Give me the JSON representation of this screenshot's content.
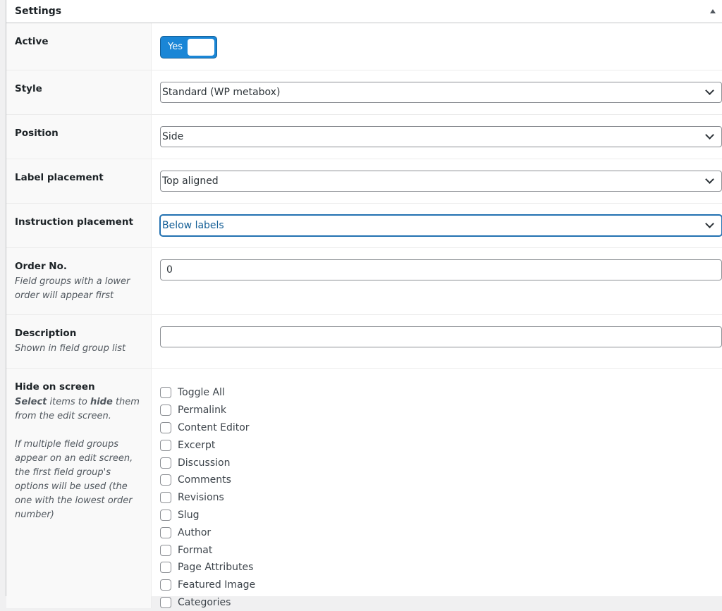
{
  "panel": {
    "title": "Settings"
  },
  "active": {
    "label": "Active",
    "toggle_text": "Yes"
  },
  "style": {
    "label": "Style",
    "value": "Standard (WP metabox)"
  },
  "position": {
    "label": "Position",
    "value": "Side"
  },
  "label_placement": {
    "label": "Label placement",
    "value": "Top aligned"
  },
  "instruction_placement": {
    "label": "Instruction placement",
    "value": "Below labels"
  },
  "order": {
    "label": "Order No.",
    "description": "Field groups with a lower order will appear first",
    "value": "0"
  },
  "description": {
    "label": "Description",
    "hint": "Shown in field group list",
    "value": ""
  },
  "hide_on_screen": {
    "label": "Hide on screen",
    "desc_select": "Select",
    "desc_items_to": " items to ",
    "desc_hide": "hide",
    "desc_rest": " them from the edit screen.",
    "desc_para2": "If multiple field groups appear on an edit screen, the first field group's options will be used (the one with the lowest order number)",
    "items": [
      "Toggle All",
      "Permalink",
      "Content Editor",
      "Excerpt",
      "Discussion",
      "Comments",
      "Revisions",
      "Slug",
      "Author",
      "Format",
      "Page Attributes",
      "Featured Image",
      "Categories"
    ]
  }
}
